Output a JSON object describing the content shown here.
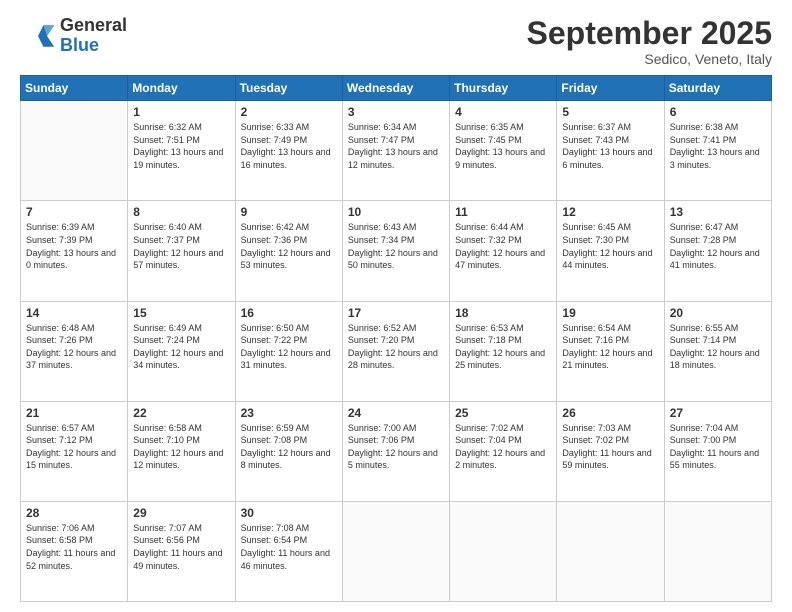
{
  "logo": {
    "general": "General",
    "blue": "Blue"
  },
  "title": "September 2025",
  "subtitle": "Sedico, Veneto, Italy",
  "weekdays": [
    "Sunday",
    "Monday",
    "Tuesday",
    "Wednesday",
    "Thursday",
    "Friday",
    "Saturday"
  ],
  "weeks": [
    [
      {
        "day": "",
        "empty": true
      },
      {
        "day": "1",
        "sunrise": "6:32 AM",
        "sunset": "7:51 PM",
        "daylight": "13 hours and 19 minutes."
      },
      {
        "day": "2",
        "sunrise": "6:33 AM",
        "sunset": "7:49 PM",
        "daylight": "13 hours and 16 minutes."
      },
      {
        "day": "3",
        "sunrise": "6:34 AM",
        "sunset": "7:47 PM",
        "daylight": "13 hours and 12 minutes."
      },
      {
        "day": "4",
        "sunrise": "6:35 AM",
        "sunset": "7:45 PM",
        "daylight": "13 hours and 9 minutes."
      },
      {
        "day": "5",
        "sunrise": "6:37 AM",
        "sunset": "7:43 PM",
        "daylight": "13 hours and 6 minutes."
      },
      {
        "day": "6",
        "sunrise": "6:38 AM",
        "sunset": "7:41 PM",
        "daylight": "13 hours and 3 minutes."
      }
    ],
    [
      {
        "day": "7",
        "sunrise": "6:39 AM",
        "sunset": "7:39 PM",
        "daylight": "13 hours and 0 minutes."
      },
      {
        "day": "8",
        "sunrise": "6:40 AM",
        "sunset": "7:37 PM",
        "daylight": "12 hours and 57 minutes."
      },
      {
        "day": "9",
        "sunrise": "6:42 AM",
        "sunset": "7:36 PM",
        "daylight": "12 hours and 53 minutes."
      },
      {
        "day": "10",
        "sunrise": "6:43 AM",
        "sunset": "7:34 PM",
        "daylight": "12 hours and 50 minutes."
      },
      {
        "day": "11",
        "sunrise": "6:44 AM",
        "sunset": "7:32 PM",
        "daylight": "12 hours and 47 minutes."
      },
      {
        "day": "12",
        "sunrise": "6:45 AM",
        "sunset": "7:30 PM",
        "daylight": "12 hours and 44 minutes."
      },
      {
        "day": "13",
        "sunrise": "6:47 AM",
        "sunset": "7:28 PM",
        "daylight": "12 hours and 41 minutes."
      }
    ],
    [
      {
        "day": "14",
        "sunrise": "6:48 AM",
        "sunset": "7:26 PM",
        "daylight": "12 hours and 37 minutes."
      },
      {
        "day": "15",
        "sunrise": "6:49 AM",
        "sunset": "7:24 PM",
        "daylight": "12 hours and 34 minutes."
      },
      {
        "day": "16",
        "sunrise": "6:50 AM",
        "sunset": "7:22 PM",
        "daylight": "12 hours and 31 minutes."
      },
      {
        "day": "17",
        "sunrise": "6:52 AM",
        "sunset": "7:20 PM",
        "daylight": "12 hours and 28 minutes."
      },
      {
        "day": "18",
        "sunrise": "6:53 AM",
        "sunset": "7:18 PM",
        "daylight": "12 hours and 25 minutes."
      },
      {
        "day": "19",
        "sunrise": "6:54 AM",
        "sunset": "7:16 PM",
        "daylight": "12 hours and 21 minutes."
      },
      {
        "day": "20",
        "sunrise": "6:55 AM",
        "sunset": "7:14 PM",
        "daylight": "12 hours and 18 minutes."
      }
    ],
    [
      {
        "day": "21",
        "sunrise": "6:57 AM",
        "sunset": "7:12 PM",
        "daylight": "12 hours and 15 minutes."
      },
      {
        "day": "22",
        "sunrise": "6:58 AM",
        "sunset": "7:10 PM",
        "daylight": "12 hours and 12 minutes."
      },
      {
        "day": "23",
        "sunrise": "6:59 AM",
        "sunset": "7:08 PM",
        "daylight": "12 hours and 8 minutes."
      },
      {
        "day": "24",
        "sunrise": "7:00 AM",
        "sunset": "7:06 PM",
        "daylight": "12 hours and 5 minutes."
      },
      {
        "day": "25",
        "sunrise": "7:02 AM",
        "sunset": "7:04 PM",
        "daylight": "12 hours and 2 minutes."
      },
      {
        "day": "26",
        "sunrise": "7:03 AM",
        "sunset": "7:02 PM",
        "daylight": "11 hours and 59 minutes."
      },
      {
        "day": "27",
        "sunrise": "7:04 AM",
        "sunset": "7:00 PM",
        "daylight": "11 hours and 55 minutes."
      }
    ],
    [
      {
        "day": "28",
        "sunrise": "7:06 AM",
        "sunset": "6:58 PM",
        "daylight": "11 hours and 52 minutes."
      },
      {
        "day": "29",
        "sunrise": "7:07 AM",
        "sunset": "6:56 PM",
        "daylight": "11 hours and 49 minutes."
      },
      {
        "day": "30",
        "sunrise": "7:08 AM",
        "sunset": "6:54 PM",
        "daylight": "11 hours and 46 minutes."
      },
      {
        "day": "",
        "empty": true
      },
      {
        "day": "",
        "empty": true
      },
      {
        "day": "",
        "empty": true
      },
      {
        "day": "",
        "empty": true
      }
    ]
  ]
}
